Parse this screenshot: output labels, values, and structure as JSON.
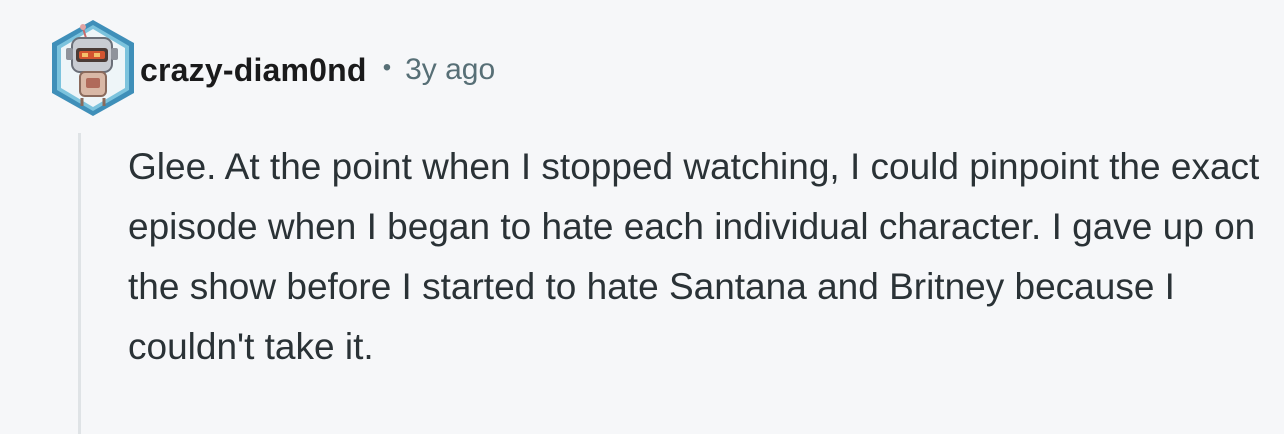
{
  "comment": {
    "author": "crazy-diam0nd",
    "separator": "•",
    "time_ago": "3y ago",
    "avatar_icon": "snoo-robot-avatar-icon",
    "body": "Glee. At the point when I stopped watching, I could pinpoint the exact episode when I began to hate each individual character. I gave up on the show before I started to hate Santana and Britney because I couldn't take it."
  },
  "colors": {
    "background": "#f6f7f9",
    "username": "#1a1a1b",
    "meta": "#576f76",
    "body_text": "#2a3236",
    "thread_line": "#dfe3e6",
    "avatar_ring": "#5aa7c9"
  }
}
